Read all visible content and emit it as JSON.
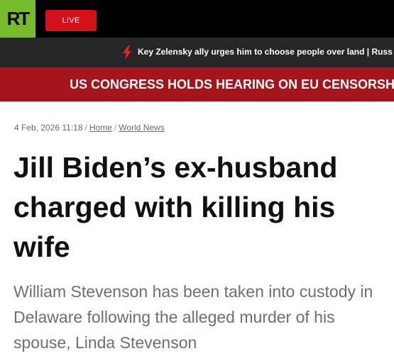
{
  "header": {
    "logo_text": "RT",
    "live_label": "LIVE",
    "ticker_icon": "lightning-bolt-icon",
    "ticker_text": "Key Zelensky ally urges him to choose people over land | Russ",
    "breaking_text": "US CONGRESS HOLDS HEARING ON EU CENSORSHIP"
  },
  "article": {
    "date": "4 Feb, 2026 11:18",
    "breadcrumb": [
      "Home",
      "World News"
    ],
    "headline": "Jill Biden’s ex-husband charged with killing his wife",
    "lead": "William Stevenson has been taken into custody in Delaware following the alleged murder of his spouse, Linda Stevenson"
  },
  "colors": {
    "logo_bg": "#77bb2a",
    "live_bg": "#d4101a",
    "breaking_bg": "#a3141b",
    "ticker_bg": "#262626",
    "bolt": "#e3232b"
  }
}
